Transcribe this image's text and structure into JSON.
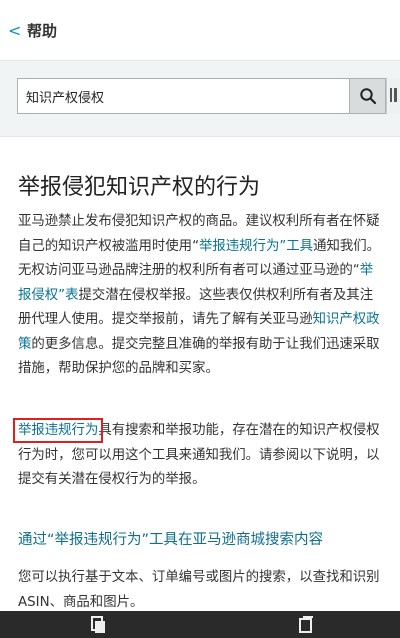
{
  "header": {
    "back_glyph": "<",
    "title": "帮助"
  },
  "search": {
    "value": "知识产权侵权",
    "placeholder": ""
  },
  "article": {
    "title": "举报侵犯知识产权的行为",
    "p1": {
      "t1": "亚马逊禁止发布侵犯知识产权的商品。建议权利所有者在怀疑自己的知识产权被滥用时使用“",
      "link1": "举报违规行为”工具",
      "t2": "通知我们。无权访问亚马逊品牌注册的权利所有者可以通过亚马逊的“",
      "link2": "举报侵权”表",
      "t3": "提交潜在侵权举报。这些表仅供权利所有者及其注册代理人使用。提交举报前，请先了解有关亚马逊",
      "link3": "知识产权政策",
      "t4": "的更多信息。提交完整且准确的举报有助于让我们迅速采取措施，帮助保护您的品牌和买家。"
    },
    "p2": {
      "link": "举报违规行为",
      "text": "具有搜索和举报功能，存在潜在的知识产权侵权行为时，您可以用这个工具来通知我们。请参阅以下说明，以提交有关潜在侵权行为的举报。"
    },
    "section_heading": "通过“举报违规行为”工具在亚马逊商城搜索内容",
    "p3": "您可以执行基于文本、订单编号或图片的搜索，以查找和识别 ASIN、商品和图片。"
  },
  "icons": {
    "search_button": "search-icon",
    "edge_button": "scan-icon",
    "bottom_left": "page-icon",
    "bottom_right": "tabs-icon"
  },
  "colors": {
    "link": "#0a7396",
    "highlight_box": "#e02020",
    "search_band": "#f1f4f5"
  }
}
